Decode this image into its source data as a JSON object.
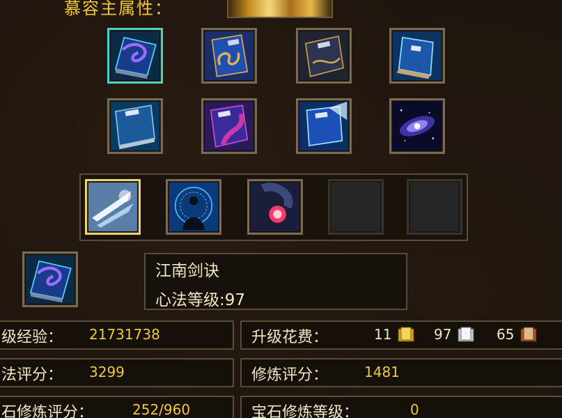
{
  "attributes": {
    "title": "慕容主属性："
  },
  "book_grid": {
    "row1": [
      "book-purple-swirl",
      "book-blue-gold",
      "book-dark-gold",
      "book-blue-open"
    ],
    "row2": [
      "book-blue-plain",
      "book-purple-pink",
      "book-blue-light",
      "galaxy"
    ]
  },
  "skill_bar": {
    "slots": [
      "ice-slash",
      "meditation-figure",
      "red-orb",
      "empty",
      "empty"
    ]
  },
  "selected_skill": {
    "icon": "book-purple-swirl",
    "name": "江南剑诀",
    "level_label": "心法等级:",
    "level_value": "97"
  },
  "stats": {
    "exp_label": "级经验：",
    "exp_value": "21731738",
    "upgrade_cost_label": "升级花费：",
    "cost_gold": "11",
    "cost_silver": "97",
    "cost_copper": "65",
    "skill_score_label": "法评分：",
    "skill_score_value": "3299",
    "cultivation_score_label": "修炼评分：",
    "cultivation_score_value": "1481",
    "gem_score_label": "石修炼评分：",
    "gem_score_value": "252/960",
    "gem_level_label": "宝石修炼等级：",
    "gem_level_value": "0"
  }
}
